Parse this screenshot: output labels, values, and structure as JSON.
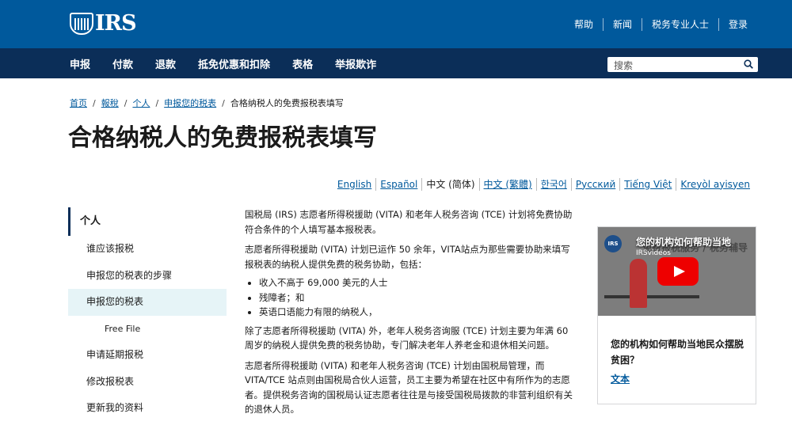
{
  "header": {
    "logo_text": "IRS",
    "util_links": [
      "帮助",
      "新闻",
      "税务专业人士",
      "登录"
    ]
  },
  "nav": {
    "items": [
      "申报",
      "付款",
      "退款",
      "抵免优惠和扣除",
      "表格",
      "举报欺诈"
    ],
    "search_placeholder": "搜索"
  },
  "breadcrumb": {
    "items": [
      "首页",
      "報稅",
      "个人",
      "申报您的税表"
    ],
    "current": "合格纳税人的免费报税表填写"
  },
  "page_title": "合格纳税人的免费报税表填写",
  "languages": {
    "items": [
      "English",
      "Español",
      "中文 (简体)",
      "中文 (繁體)",
      "한국어",
      "Русский",
      "Tiếng Việt",
      "Kreyòl ayisyen"
    ],
    "current_index": 2
  },
  "sidenav": {
    "heading": "个人",
    "items": [
      {
        "label": "谁应该报税"
      },
      {
        "label": "申报您的税表的步骤"
      },
      {
        "label": "申报您的税表"
      },
      {
        "label": "Free File"
      },
      {
        "label": "申请延期报税"
      },
      {
        "label": "修改报税表"
      },
      {
        "label": "更新我的资料"
      }
    ]
  },
  "content": {
    "p1": "国税局 (IRS) 志愿者所得税援助 (VITA) 和老年人税务咨询 (TCE) 计划将免费协助符合条件的个人填写基本报税表。",
    "p2": "志愿者所得税援助 (VITA) 计划已运作 50 余年，VITA站点为那些需要协助来填写报税表的纳税人提供免费的税务协助，包括：",
    "bullets": [
      "收入不高于 69,000 美元的人士",
      "残障者；和",
      "英语口语能力有限的纳税人，"
    ],
    "p3": "除了志愿者所得税援助 (VITA) 外，老年人税务咨询服 (TCE) 计划主要为年满 60 周岁的纳税人提供免费的税务协助，专门解决老年人养老金和退休相关问题。",
    "p4": "志愿者所得税援助 (VITA) 和老年人税务咨询 (TCE) 计划由国税局管理，而 VITA/TCE 站点则由国税局合伙人运营，员工主要为希望在社区中有所作为的志愿者。提供税务咨询的国税局认证志愿者往往是与接受国税局拨款的非营利组织有关的退休人员。"
  },
  "video": {
    "badge": "IRS",
    "thumb_title": "您的机构如何帮助当地",
    "thumb_sub": "IRSvideos",
    "thumb_bg_text": "免费报税服务 / 税务辅导",
    "title": "您的机构如何帮助当地民众摆脱贫困？",
    "link": "文本"
  }
}
